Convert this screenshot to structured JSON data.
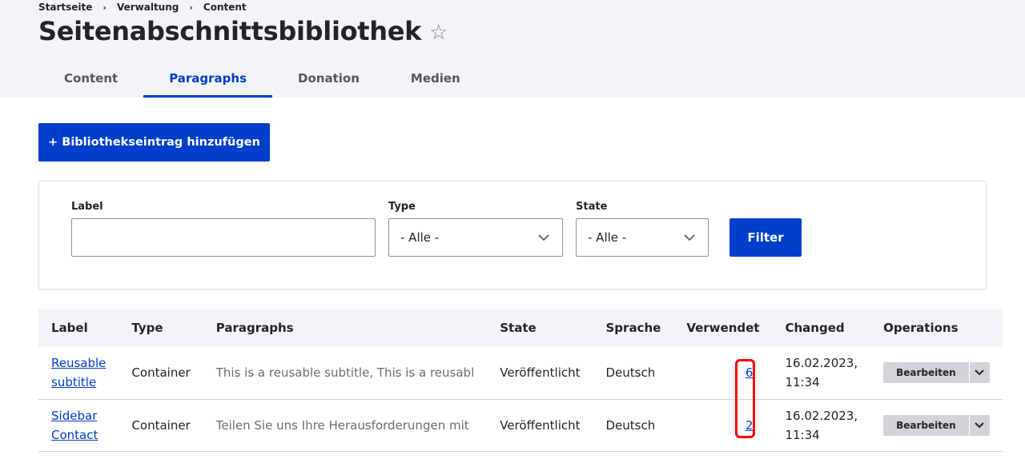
{
  "breadcrumb": [
    "Startseite",
    "Verwaltung",
    "Content"
  ],
  "breadcrumb_separator": "›",
  "header": {
    "title": "Seitenabschnittsbibliothek",
    "star_icon": "☆"
  },
  "tabs": [
    {
      "label": "Content",
      "active": false
    },
    {
      "label": "Paragraphs",
      "active": true
    },
    {
      "label": "Donation",
      "active": false
    },
    {
      "label": "Medien",
      "active": false
    }
  ],
  "add_button": {
    "label": "+ Bibliothekseintrag hinzufügen"
  },
  "filters": {
    "label": {
      "label": "Label",
      "value": ""
    },
    "type": {
      "label": "Type",
      "value": "- Alle -"
    },
    "state": {
      "label": "State",
      "value": "- Alle -"
    },
    "submit": "Filter"
  },
  "table": {
    "headers": [
      "Label",
      "Type",
      "Paragraphs",
      "State",
      "Sprache",
      "Verwendet",
      "Changed",
      "Operations"
    ],
    "rows": [
      {
        "label_line1": "Reusable",
        "label_line2": "subtitle",
        "type": "Container",
        "paragraphs": "This is a reusable subtitle, This is a reusabl",
        "state": "Veröffentlicht",
        "language": "Deutsch",
        "used": "6",
        "changed_line1": "16.02.2023,",
        "changed_line2": "11:34",
        "op_label": "Bearbeiten"
      },
      {
        "label_line1": "Sidebar",
        "label_line2": "Contact",
        "type": "Container",
        "paragraphs": "Teilen Sie uns Ihre Herausforderungen mit",
        "state": "Veröffentlicht",
        "language": "Deutsch",
        "used": "2",
        "changed_line1": "16.02.2023,",
        "changed_line2": "11:34",
        "op_label": "Bearbeiten"
      }
    ]
  },
  "colors": {
    "accent": "#003ecc",
    "highlight": "#ff0000",
    "header_bg": "#f3f4f9"
  }
}
